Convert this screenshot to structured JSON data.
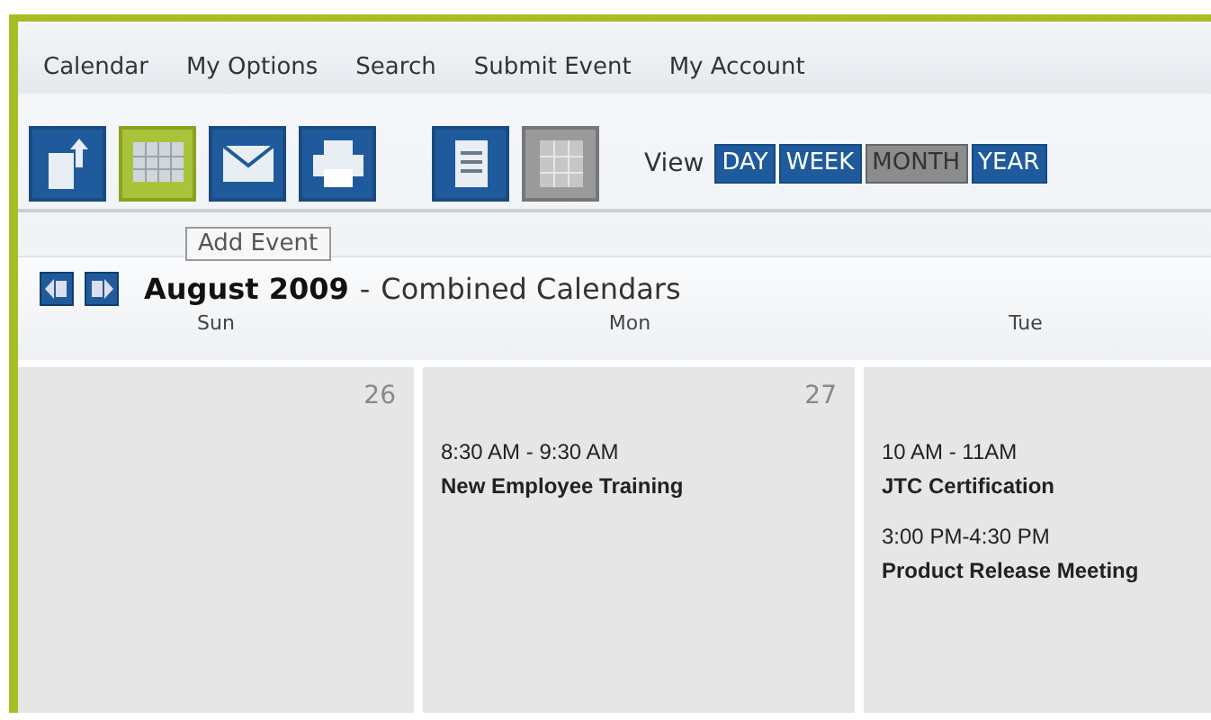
{
  "menu": [
    {
      "label": "Calendar"
    },
    {
      "label": "My Options"
    },
    {
      "label": "Search"
    },
    {
      "label": "Submit Event"
    },
    {
      "label": "My Account"
    }
  ],
  "tools": [
    {
      "kind": "export",
      "highlighted": false
    },
    {
      "kind": "add",
      "highlighted": true
    },
    {
      "kind": "email",
      "highlighted": false
    },
    {
      "kind": "print",
      "highlighted": false
    }
  ],
  "layouts": [
    {
      "kind": "list",
      "selected": false
    },
    {
      "kind": "grid",
      "selected": true
    }
  ],
  "view": {
    "label": "View",
    "options": [
      {
        "label": "DAY",
        "selected": false
      },
      {
        "label": "WEEK",
        "selected": false
      },
      {
        "label": "MONTH",
        "selected": true
      },
      {
        "label": "YEAR",
        "selected": false
      }
    ]
  },
  "tooltip": "Add Event",
  "header": {
    "month": "August 2009",
    "separator": "-",
    "subtitle": "Combined Calendars"
  },
  "weekdays": [
    "Sun",
    "Mon",
    "Tue"
  ],
  "days": [
    {
      "date": "26"
    },
    {
      "date": "27",
      "events": [
        {
          "time": "8:30 AM - 9:30 AM",
          "title": "New Employee Training"
        }
      ]
    },
    {
      "events": [
        {
          "time": "10 AM - 11AM",
          "title": "JTC Certification"
        },
        {
          "time": "3:00 PM-4:30 PM",
          "title": "Product Release Meeting"
        }
      ]
    }
  ]
}
